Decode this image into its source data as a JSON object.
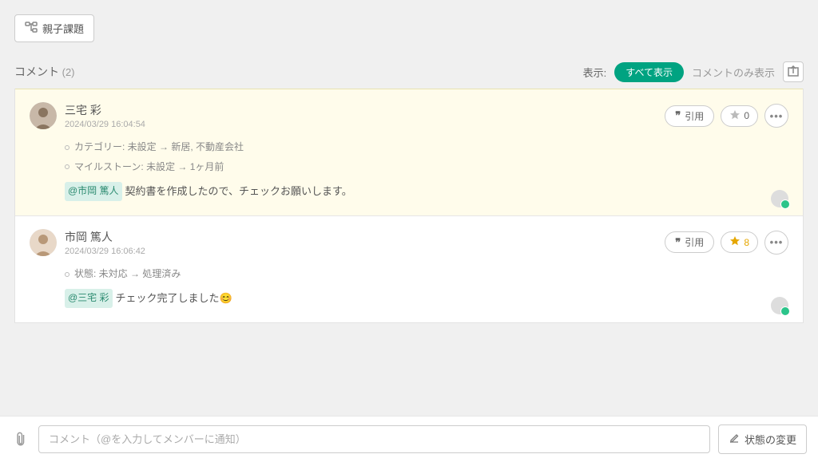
{
  "top": {
    "parentChild": "親子課題"
  },
  "commentsHeader": {
    "title": "コメント",
    "count": "(2)",
    "displayLabel": "表示:",
    "showAll": "すべて表示",
    "commentsOnly": "コメントのみ表示"
  },
  "comments": [
    {
      "author": "三宅 彩",
      "timestamp": "2024/03/29 16:04:54",
      "quoteLabel": "引用",
      "starCount": "0",
      "starActive": false,
      "changes": [
        "カテゴリー: 未設定 → 新居, 不動産会社",
        "マイルストーン: 未設定 → 1ヶ月前"
      ],
      "mention": "@市岡 篤人",
      "message": "契約書を作成したので、チェックお願いします。"
    },
    {
      "author": "市岡 篤人",
      "timestamp": "2024/03/29 16:06:42",
      "quoteLabel": "引用",
      "starCount": "8",
      "starActive": true,
      "changes": [
        "状態: 未対応 → 処理済み"
      ],
      "mention": "@三宅 彩",
      "message": "チェック完了しました😊"
    }
  ],
  "bottom": {
    "placeholder": "コメント（@を入力してメンバーに通知）",
    "statusChange": "状態の変更"
  }
}
